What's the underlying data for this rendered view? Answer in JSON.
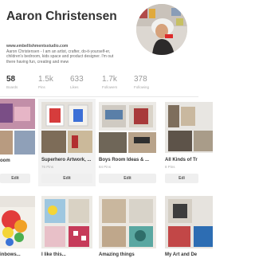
{
  "profile": {
    "name": "Aaron Christensen",
    "url": "www.embellishmentsstudio.com",
    "bio": "Aaron Christensen - I am an artist, crafter, do-it-yourself-er, children's bedroom, kids space and product designer. I'm out there having fun, creating and mew"
  },
  "stats": [
    {
      "count": "58",
      "label": "Boards"
    },
    {
      "count": "1.5k",
      "label": "Pins"
    },
    {
      "count": "633",
      "label": "Likes"
    },
    {
      "count": "1.7k",
      "label": "Followers"
    },
    {
      "count": "378",
      "label": "Following"
    }
  ],
  "boards_row1": [
    {
      "title": "oom",
      "count": "",
      "edit": "Edit"
    },
    {
      "title": "Superhero Artwork, ...",
      "count": "76 Pins",
      "edit": "Edit"
    },
    {
      "title": "Boys Room Ideas & ...",
      "count": "84 Pins",
      "edit": "Edit"
    },
    {
      "title": "All Kinds of Tr",
      "count": "8 Pins",
      "edit": "Edi"
    }
  ],
  "boards_row2": [
    {
      "title": "inbows..."
    },
    {
      "title": "I like this..."
    },
    {
      "title": "Amazing things"
    },
    {
      "title": "My Art and De"
    }
  ],
  "colors": {
    "text": "#333333",
    "muted": "#aaaaaa",
    "edit_bg": "#efefef",
    "highlight_bg": "#f2f2f2"
  }
}
